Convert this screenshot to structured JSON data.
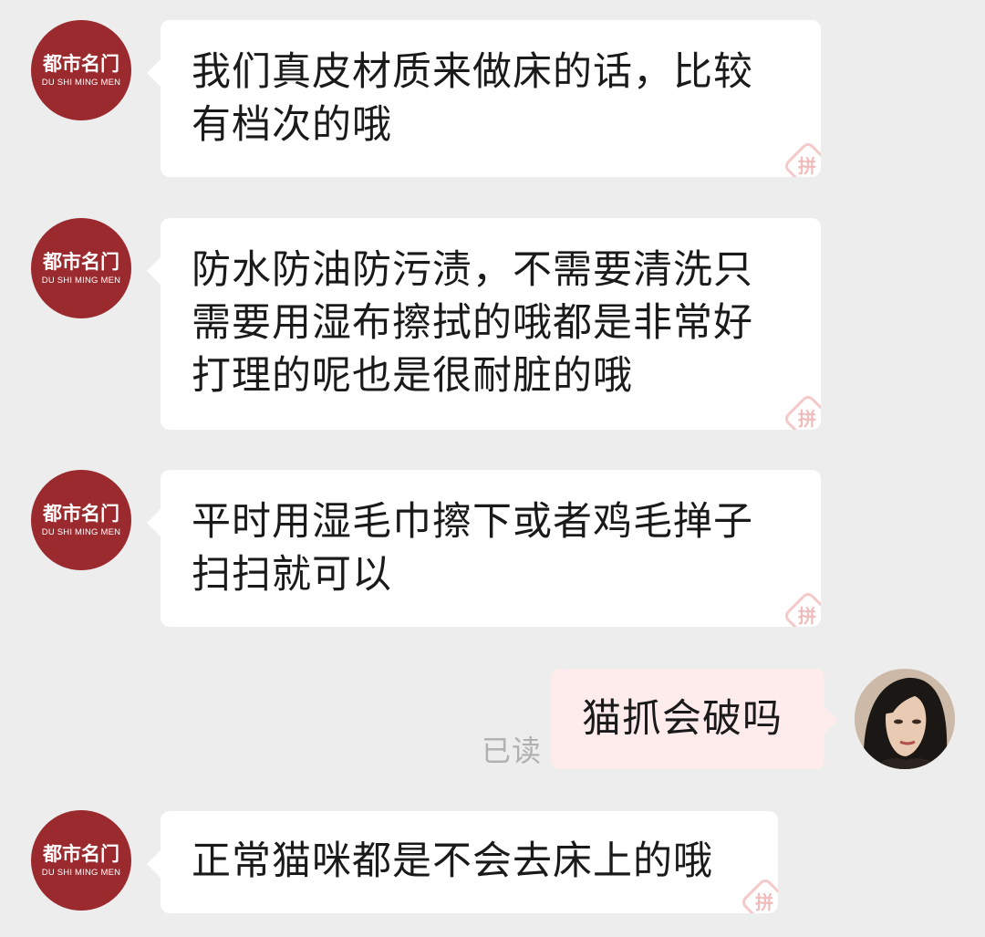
{
  "shop_avatar": {
    "name_cn": "都市名门",
    "name_en": "DU SHI MING MEN"
  },
  "messages": [
    {
      "sender": "shop",
      "lines": [
        "我们真皮材质来做床的话，比较",
        "有档次的哦"
      ]
    },
    {
      "sender": "shop",
      "lines": [
        "防水防油防污渍，不需要清洗只",
        "需要用湿布擦拭的哦都是非常好",
        "打理的呢也是很耐脏的哦"
      ]
    },
    {
      "sender": "shop",
      "lines": [
        "平时用湿毛巾擦下或者鸡毛掸子",
        "扫扫就可以"
      ]
    },
    {
      "sender": "user",
      "lines": [
        "猫抓会破吗"
      ],
      "status": "已读"
    },
    {
      "sender": "shop",
      "lines": [
        "正常猫咪都是不会去床上的哦"
      ]
    }
  ],
  "stamp_glyph": "拼",
  "colors": {
    "background": "#ededed",
    "shop_avatar": "#9b2a2e",
    "incoming_bubble": "#ffffff",
    "outgoing_bubble": "#fdeceb",
    "read_status": "#b0b0b0"
  }
}
